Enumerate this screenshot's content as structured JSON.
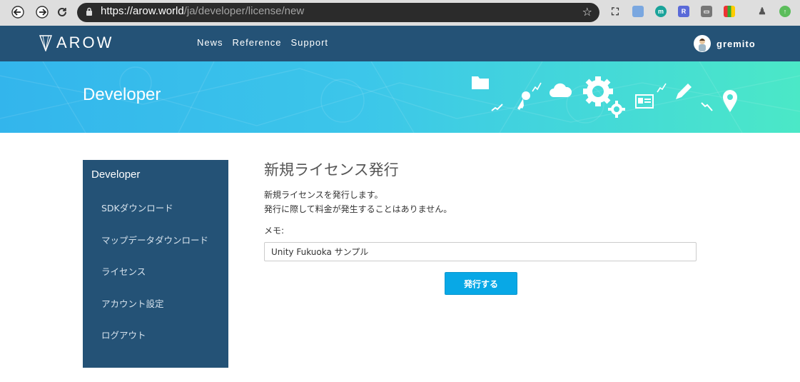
{
  "browser": {
    "url_host": "https://arow.world",
    "url_path": "/ja/developer/license/new"
  },
  "navbar": {
    "brand": "AROW",
    "menu": [
      "News",
      "Reference",
      "Support"
    ],
    "username": "gremito"
  },
  "banner": {
    "title": "Developer"
  },
  "sidebar": {
    "title": "Developer",
    "items": [
      {
        "label": "SDKダウンロード"
      },
      {
        "label": "マップデータダウンロード"
      },
      {
        "label": "ライセンス"
      },
      {
        "label": "アカウント設定"
      },
      {
        "label": "ログアウト"
      }
    ]
  },
  "main": {
    "title": "新規ライセンス発行",
    "description": [
      "新規ライセンスを発行します。",
      "発行に際して料金が発生することはありません。"
    ],
    "memo_label": "メモ:",
    "memo_value": "Unity Fukuoka サンプル",
    "submit_label": "発行する"
  },
  "colors": {
    "navbar": "#245276",
    "sidebar": "#245276",
    "button": "#08a8e6"
  }
}
